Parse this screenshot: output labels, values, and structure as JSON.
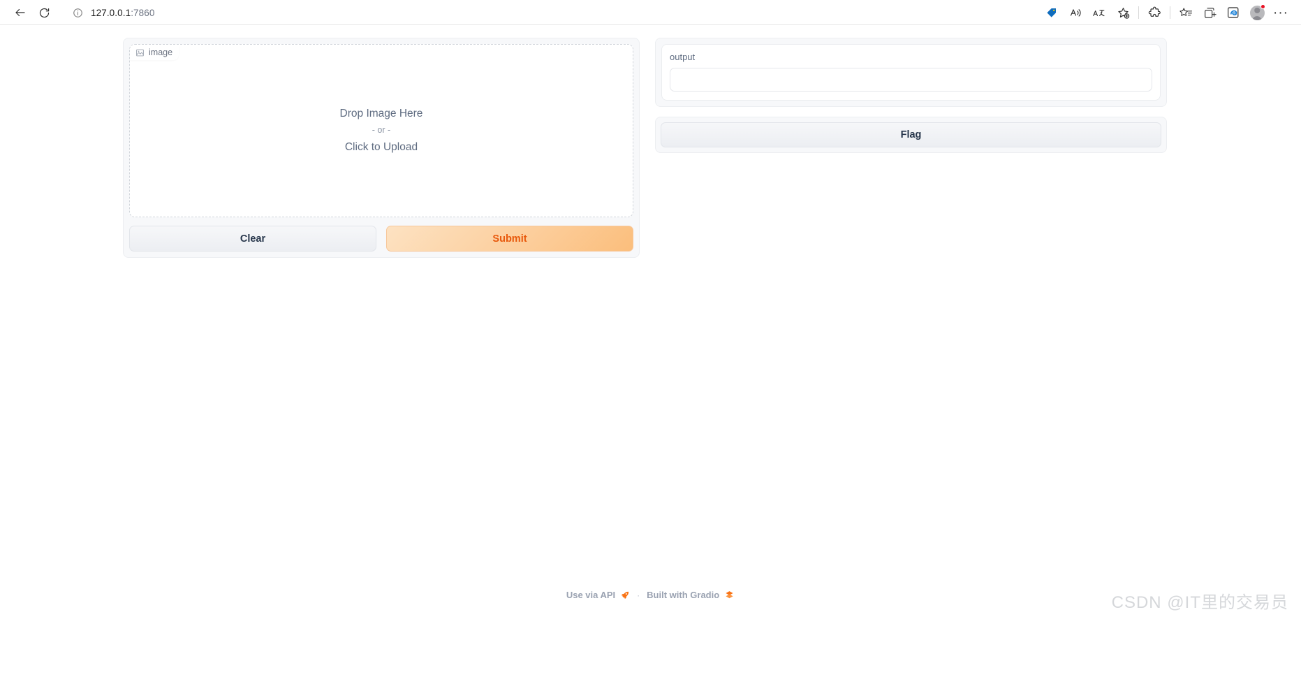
{
  "browser": {
    "back_tooltip": "Back",
    "refresh_tooltip": "Refresh",
    "url_host": "127.0.0.1",
    "url_port": ":7860",
    "toolbar_icons": [
      "shopping-tag-icon",
      "read-aloud-icon",
      "translate-icon",
      "add-favorite-icon",
      "extensions-icon",
      "collections-icon",
      "split-screen-icon",
      "ie-mode-icon",
      "profile-avatar",
      "settings-more-icon"
    ]
  },
  "app": {
    "input": {
      "label": "image",
      "label_icon": "image-icon",
      "drop_primary": "Drop Image Here",
      "drop_or": "- or -",
      "drop_click": "Click to Upload"
    },
    "buttons": {
      "clear": "Clear",
      "submit": "Submit",
      "flag": "Flag"
    },
    "output": {
      "label": "output",
      "value": "",
      "placeholder": ""
    }
  },
  "footer": {
    "api_text": "Use via API",
    "rocket_icon": "rocket-icon",
    "separator": "·",
    "built_with": "Built with Gradio",
    "gradio_icon": "gradio-logo-icon"
  },
  "watermark": {
    "text": "CSDN @IT里的交易员"
  },
  "colors": {
    "accent_orange": "#e8590c",
    "submit_gradient_start": "#fde2c2",
    "submit_gradient_end": "#fbbe7c",
    "panel_bg": "#f7f8fa",
    "text_primary": "#27364b",
    "text_muted": "#6b7280",
    "notification_dot": "#e81123",
    "tag_blue": "#0f6cbd"
  }
}
